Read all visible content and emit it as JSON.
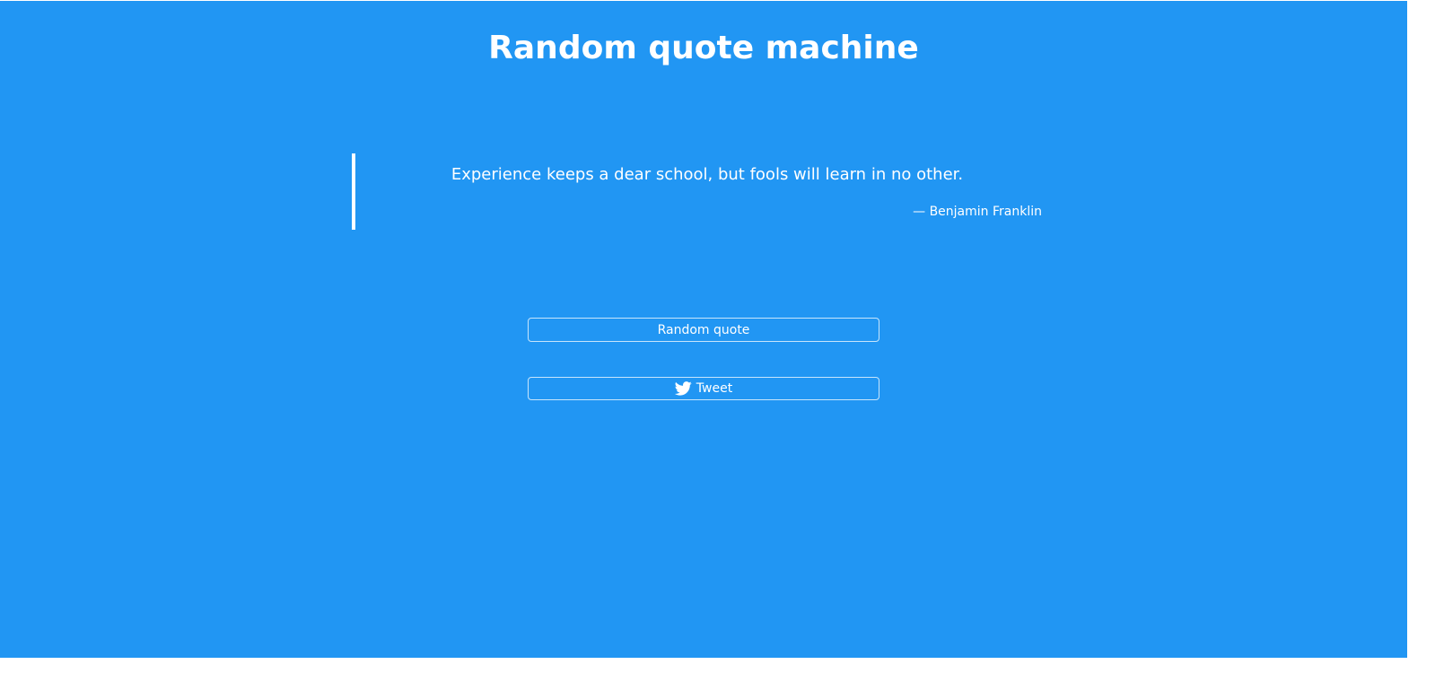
{
  "app": {
    "title": "Random quote machine",
    "background_color": "#2196f3",
    "text_color": "#ffffff"
  },
  "quote": {
    "text": "Experience keeps a dear school, but fools will learn in no other.",
    "author": "— Benjamin Franklin"
  },
  "buttons": {
    "random_label": "Random quote",
    "tweet_label": "Tweet",
    "tweet_icon": "twitter-icon"
  }
}
